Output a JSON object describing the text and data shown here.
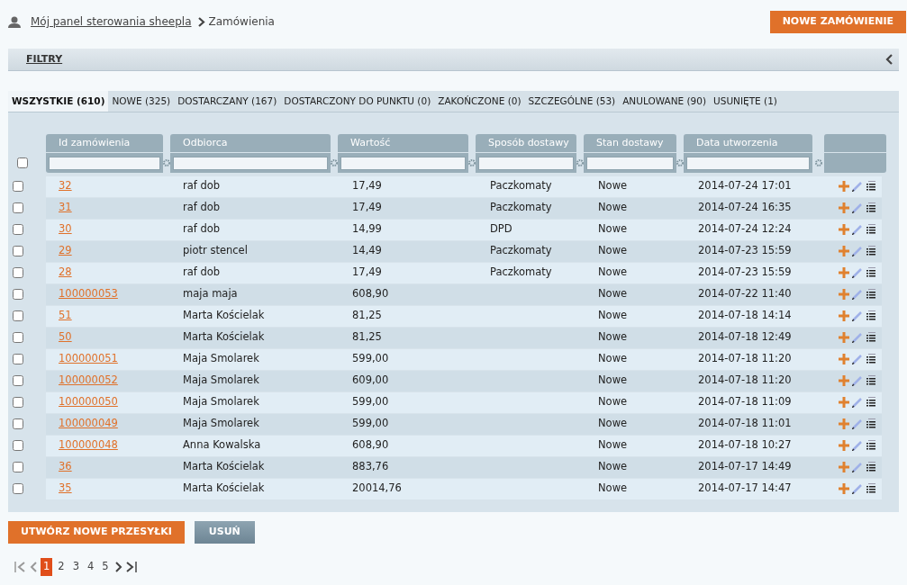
{
  "breadcrumb": {
    "link": "Mój panel sterowania sheepla",
    "current": "Zamówienia"
  },
  "new_order_button": "NOWE ZAMÓWIENIE",
  "filters": {
    "label": "FILTRY",
    "expanded": false
  },
  "tabs": [
    {
      "label": "WSZYSTKIE (610)",
      "selected": true
    },
    {
      "label": "NOWE (325)",
      "selected": false
    },
    {
      "label": "DOSTARCZANY (167)",
      "selected": false
    },
    {
      "label": "DOSTARCZONY DO PUNKTU (0)",
      "selected": false
    },
    {
      "label": "ZAKOŃCZONE (0)",
      "selected": false
    },
    {
      "label": "SZCZEGÓLNE (53)",
      "selected": false
    },
    {
      "label": "ANULOWANE (90)",
      "selected": false
    },
    {
      "label": "USUNIĘTE (1)",
      "selected": false
    }
  ],
  "table": {
    "select_all_checked": false,
    "columns": [
      "Id zamówienia",
      "Odbiorca",
      "Wartość",
      "Sposób dostawy",
      "Stan dostawy",
      "Data utworzenia"
    ],
    "rows": [
      {
        "checked": false,
        "cells": [
          "32",
          "raf dob",
          "17,49",
          "Paczkomaty",
          "Nowe",
          "2014-07-24 17:01"
        ]
      },
      {
        "checked": false,
        "cells": [
          "31",
          "raf dob",
          "17,49",
          "Paczkomaty",
          "Nowe",
          "2014-07-24 16:35"
        ]
      },
      {
        "checked": false,
        "cells": [
          "30",
          "raf dob",
          "14,99",
          "DPD",
          "Nowe",
          "2014-07-24 12:24"
        ]
      },
      {
        "checked": false,
        "cells": [
          "29",
          "piotr stencel",
          "14,49",
          "Paczkomaty",
          "Nowe",
          "2014-07-23 15:59"
        ]
      },
      {
        "checked": false,
        "cells": [
          "28",
          "raf dob",
          "17,49",
          "Paczkomaty",
          "Nowe",
          "2014-07-23 15:59"
        ]
      },
      {
        "checked": false,
        "cells": [
          "100000053",
          "maja maja",
          "608,90",
          "",
          "Nowe",
          "2014-07-22 11:40"
        ]
      },
      {
        "checked": false,
        "cells": [
          "51",
          "Marta Kościelak",
          "81,25",
          "",
          "Nowe",
          "2014-07-18 14:14"
        ]
      },
      {
        "checked": false,
        "cells": [
          "50",
          "Marta Kościelak",
          "81,25",
          "",
          "Nowe",
          "2014-07-18 12:49"
        ]
      },
      {
        "checked": false,
        "cells": [
          "100000051",
          "Maja Smolarek",
          "599,00",
          "",
          "Nowe",
          "2014-07-18 11:20"
        ]
      },
      {
        "checked": false,
        "cells": [
          "100000052",
          "Maja Smolarek",
          "609,00",
          "",
          "Nowe",
          "2014-07-18 11:20"
        ]
      },
      {
        "checked": false,
        "cells": [
          "100000050",
          "Maja Smolarek",
          "599,00",
          "",
          "Nowe",
          "2014-07-18 11:09"
        ]
      },
      {
        "checked": false,
        "cells": [
          "100000049",
          "Maja Smolarek",
          "599,00",
          "",
          "Nowe",
          "2014-07-18 11:01"
        ]
      },
      {
        "checked": false,
        "cells": [
          "100000048",
          "Anna Kowalska",
          "608,90",
          "",
          "Nowe",
          "2014-07-18 10:27"
        ]
      },
      {
        "checked": false,
        "cells": [
          "36",
          "Marta Kościelak",
          "883,76",
          "",
          "Nowe",
          "2014-07-17 14:49"
        ]
      },
      {
        "checked": false,
        "cells": [
          "35",
          "Marta Kościelak",
          "20014,76",
          "",
          "Nowe",
          "2014-07-17 14:47"
        ]
      }
    ]
  },
  "create_shipments_button": "UTWÓRZ NOWE PRZESYŁKI",
  "delete_button": "USUŃ",
  "pagination": {
    "pages": [
      {
        "label": "1",
        "selected": true
      },
      {
        "label": "2",
        "selected": false
      },
      {
        "label": "3",
        "selected": false
      },
      {
        "label": "4",
        "selected": false
      },
      {
        "label": "5",
        "selected": false
      }
    ]
  }
}
